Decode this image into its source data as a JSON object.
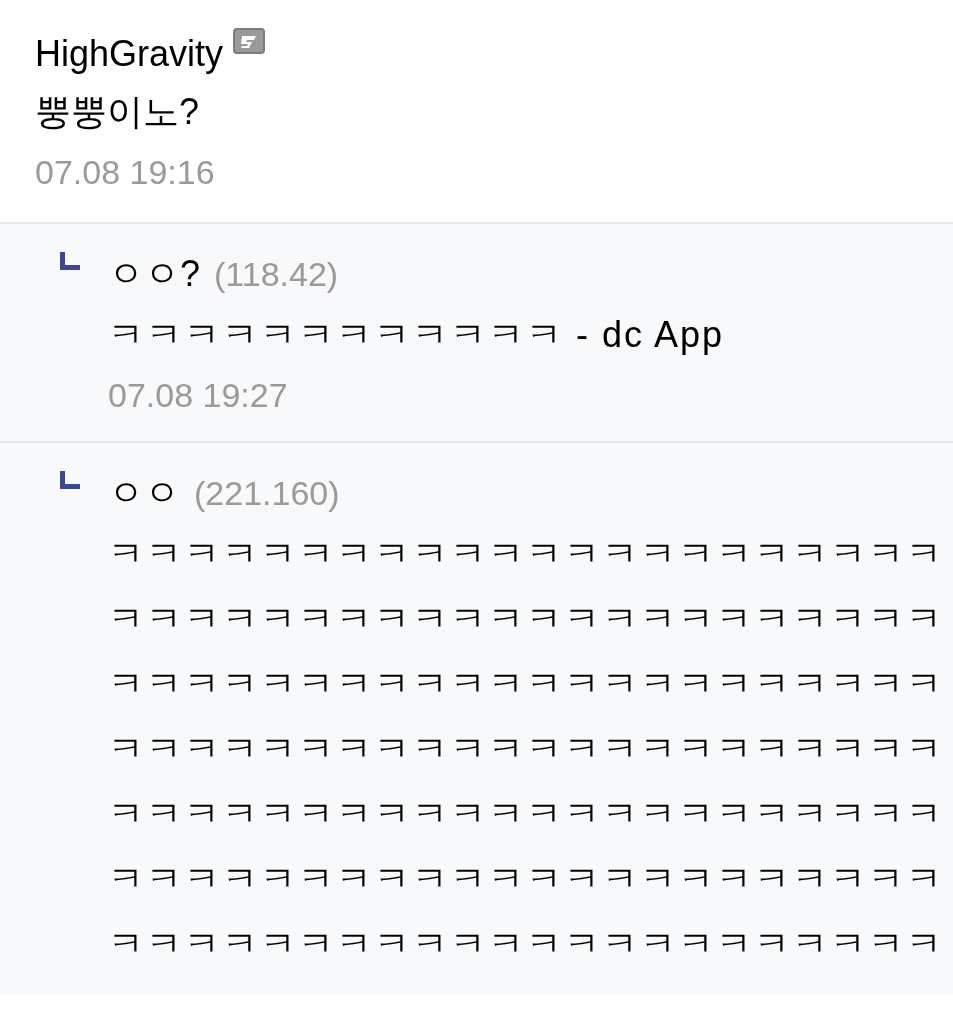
{
  "comment": {
    "author": "HighGravity",
    "body": "뿡뿡이노?",
    "time": "07.08 19:16"
  },
  "replies": [
    {
      "author": "ㅇㅇ?",
      "ip": "(118.42)",
      "lines": [
        "ㅋㅋㅋㅋㅋㅋㅋㅋㅋㅋㅋㅋ - dc App"
      ],
      "time": "07.08 19:27"
    },
    {
      "author": "ㅇㅇ",
      "ip": "(221.160)",
      "lines": [
        "ㅋㅋㅋㅋㅋㅋㅋㅋㅋㅋㅋㅋㅋㅋㅋㅋㅋㅋㅋㅋㅋㅋ",
        "ㅋㅋㅋㅋㅋㅋㅋㅋㅋㅋㅋㅋㅋㅋㅋㅋㅋㅋㅋㅋㅋㅋ",
        "ㅋㅋㅋㅋㅋㅋㅋㅋㅋㅋㅋㅋㅋㅋㅋㅋㅋㅋㅋㅋㅋㅋ",
        "ㅋㅋㅋㅋㅋㅋㅋㅋㅋㅋㅋㅋㅋㅋㅋㅋㅋㅋㅋㅋㅋㅋ",
        "ㅋㅋㅋㅋㅋㅋㅋㅋㅋㅋㅋㅋㅋㅋㅋㅋㅋㅋㅋㅋㅋㅋ",
        "ㅋㅋㅋㅋㅋㅋㅋㅋㅋㅋㅋㅋㅋㅋㅋㅋㅋㅋㅋㅋㅋㅋ",
        "ㅋㅋㅋㅋㅋㅋㅋㅋㅋㅋㅋㅋㅋㅋㅋㅋㅋㅋㅋㅋㅋㅋ"
      ]
    }
  ]
}
